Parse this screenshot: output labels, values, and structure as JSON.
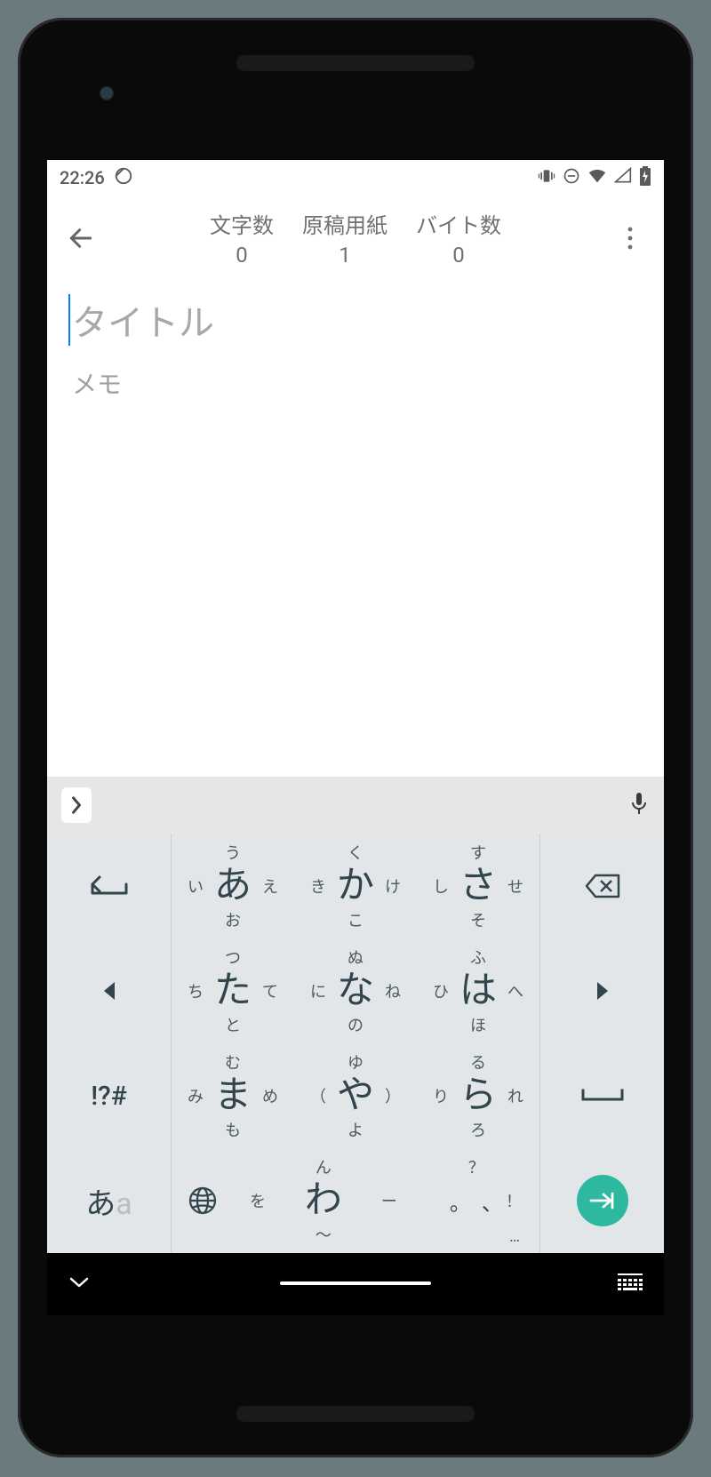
{
  "status": {
    "time": "22:26"
  },
  "appbar": {
    "counters": [
      {
        "label": "文字数",
        "value": "0"
      },
      {
        "label": "原稿用紙",
        "value": "1"
      },
      {
        "label": "バイト数",
        "value": "0"
      }
    ]
  },
  "editor": {
    "title_placeholder": "タイトル",
    "memo_placeholder": "メモ"
  },
  "keyboard": {
    "rows": [
      [
        {
          "type": "side-icon",
          "name": "undo"
        },
        {
          "main": "あ",
          "t": "う",
          "b": "お",
          "l": "い",
          "r": "え"
        },
        {
          "main": "か",
          "t": "く",
          "b": "こ",
          "l": "き",
          "r": "け"
        },
        {
          "main": "さ",
          "t": "す",
          "b": "そ",
          "l": "し",
          "r": "せ"
        },
        {
          "type": "side-icon",
          "name": "backspace"
        }
      ],
      [
        {
          "type": "side-icon",
          "name": "left"
        },
        {
          "main": "た",
          "t": "つ",
          "b": "と",
          "l": "ち",
          "r": "て"
        },
        {
          "main": "な",
          "t": "ぬ",
          "b": "の",
          "l": "に",
          "r": "ね"
        },
        {
          "main": "は",
          "t": "ふ",
          "b": "ほ",
          "l": "ひ",
          "r": "へ"
        },
        {
          "type": "side-icon",
          "name": "right"
        }
      ],
      [
        {
          "type": "side-text",
          "text": "!?#",
          "name": "symbols"
        },
        {
          "main": "ま",
          "t": "む",
          "b": "も",
          "l": "み",
          "r": "め"
        },
        {
          "main": "や",
          "t": "ゆ",
          "b": "よ",
          "l": "（",
          "r": "）"
        },
        {
          "main": "ら",
          "t": "る",
          "b": "ろ",
          "l": "り",
          "r": "れ"
        },
        {
          "type": "side-icon",
          "name": "space"
        }
      ],
      [
        {
          "type": "lang",
          "active": "あ",
          "inactive": "a"
        },
        {
          "type": "globe"
        },
        {
          "main": "わ",
          "t": "ん",
          "b": "〜",
          "l": "を",
          "r": "ー"
        },
        {
          "type": "punct",
          "items": [
            "。",
            "、",
            "？",
            "！",
            "…"
          ]
        },
        {
          "type": "enter"
        }
      ]
    ]
  }
}
